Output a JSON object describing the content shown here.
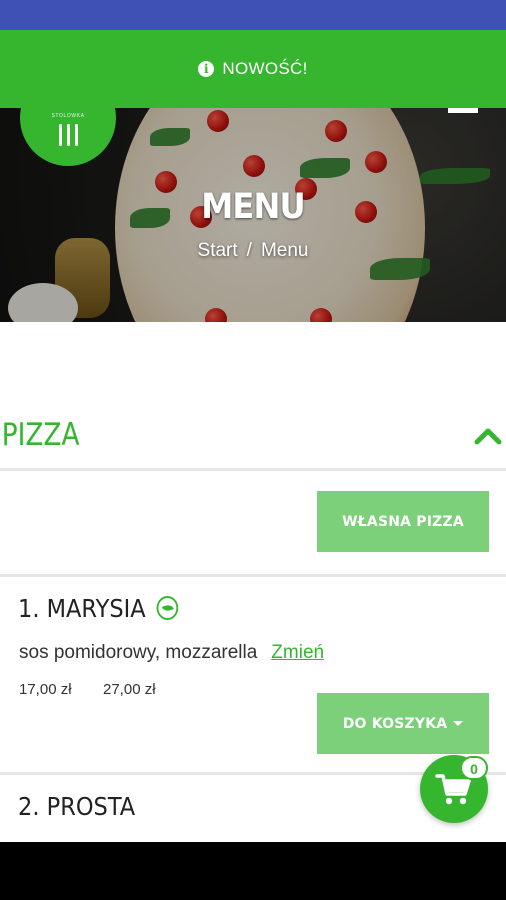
{
  "notice": {
    "icon": "info-icon",
    "label": "NOWOŚĆ!"
  },
  "logo": {
    "name": "STOLOWKA",
    "icon": "cutlery-icon"
  },
  "hero": {
    "title": "MENU",
    "breadcrumb": {
      "home": "Start",
      "separator": "/",
      "current": "Menu"
    }
  },
  "category": {
    "title": "PIZZA",
    "toggle_icon": "chevron-up-icon"
  },
  "custom_pizza_button": "WŁASNA PIZZA",
  "items": [
    {
      "title": "1. MARYSIA",
      "badge_icon": "vegetarian-icon",
      "description": "sos pomidorowy, mozzarella",
      "change_label": "Zmień",
      "prices": [
        "17,00 zł",
        "27,00 zł"
      ],
      "add_to_cart_label": "DO KOSZYKA"
    },
    {
      "title": "2. PROSTA"
    }
  ],
  "cart": {
    "icon": "cart-icon",
    "count": "0"
  },
  "colors": {
    "accent": "#35b62e",
    "button": "#7cd07a",
    "status_bar": "#3f51b5"
  }
}
